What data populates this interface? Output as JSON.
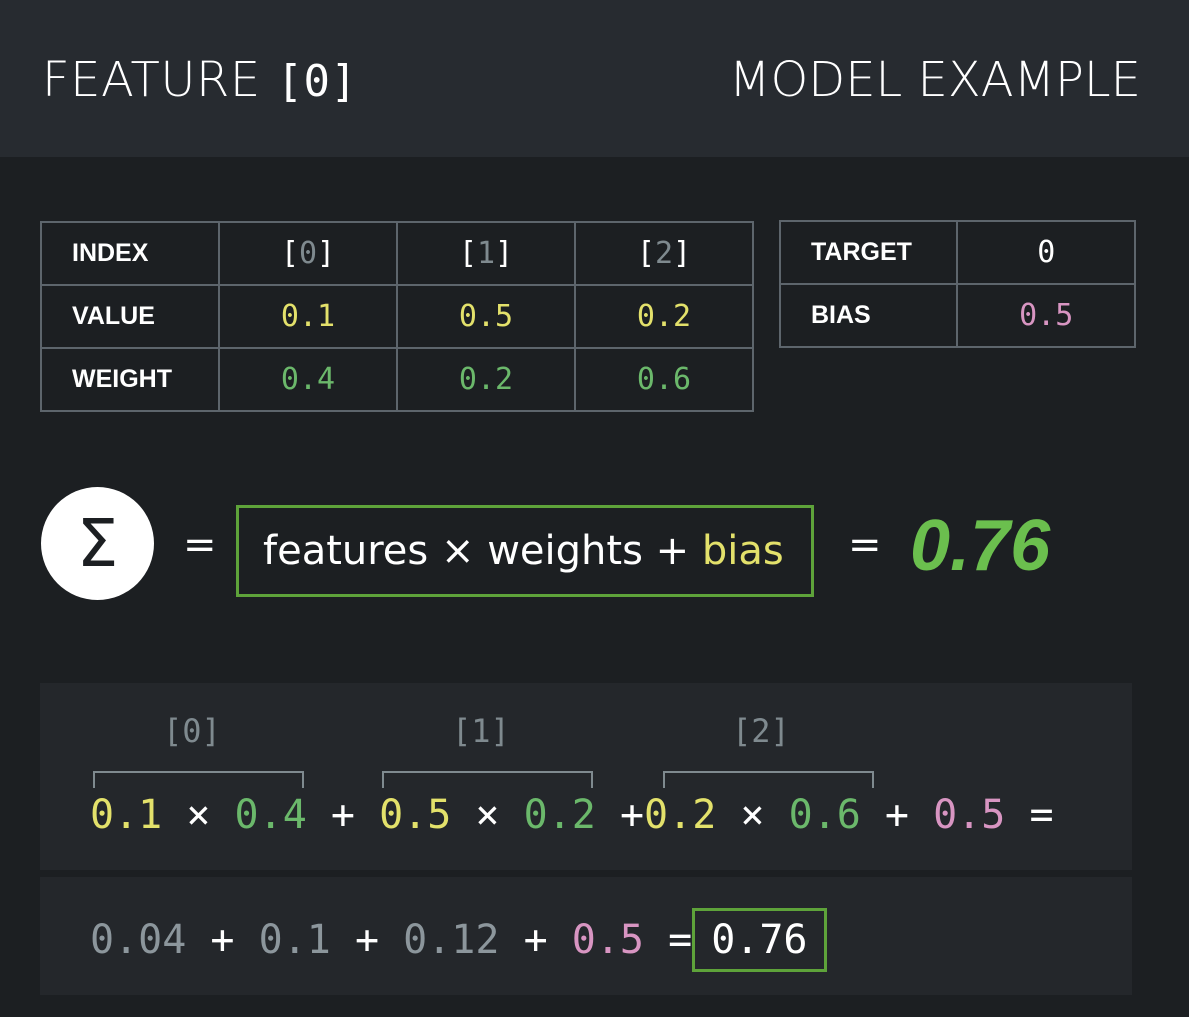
{
  "header": {
    "left_label": "FEATURE",
    "left_index": "[0]",
    "right_title": "MODEL EXAMPLE"
  },
  "feature_table": {
    "rows": [
      {
        "label": "INDEX",
        "cells": [
          "[0]",
          "[1]",
          "[2]"
        ]
      },
      {
        "label": "VALUE",
        "cells": [
          "0.1",
          "0.5",
          "0.2"
        ]
      },
      {
        "label": "WEIGHT",
        "cells": [
          "0.4",
          "0.2",
          "0.6"
        ]
      }
    ]
  },
  "target_table": {
    "target_label": "TARGET",
    "target_value": "0",
    "bias_label": "BIAS",
    "bias_value": "0.5"
  },
  "formula": {
    "symbol": "Σ",
    "equals": "=",
    "text_main": "features × weights + ",
    "text_bias": "bias",
    "result": "0.76"
  },
  "expansion": {
    "indices": [
      "[0]",
      "[1]",
      "[2]"
    ],
    "terms": [
      {
        "value": "0.1",
        "weight": "0.4"
      },
      {
        "value": "0.5",
        "weight": "0.2"
      },
      {
        "value": "0.2",
        "weight": "0.6"
      }
    ],
    "bias": "0.5",
    "times": "×",
    "plus": "+",
    "equals": "="
  },
  "products": {
    "values": [
      "0.04",
      "0.1",
      "0.12"
    ],
    "bias": "0.5",
    "result": "0.76"
  },
  "colors": {
    "value": "#e3e16b",
    "weight": "#6bb86b",
    "bias": "#d895c2",
    "accent_green": "#5ea33a"
  }
}
